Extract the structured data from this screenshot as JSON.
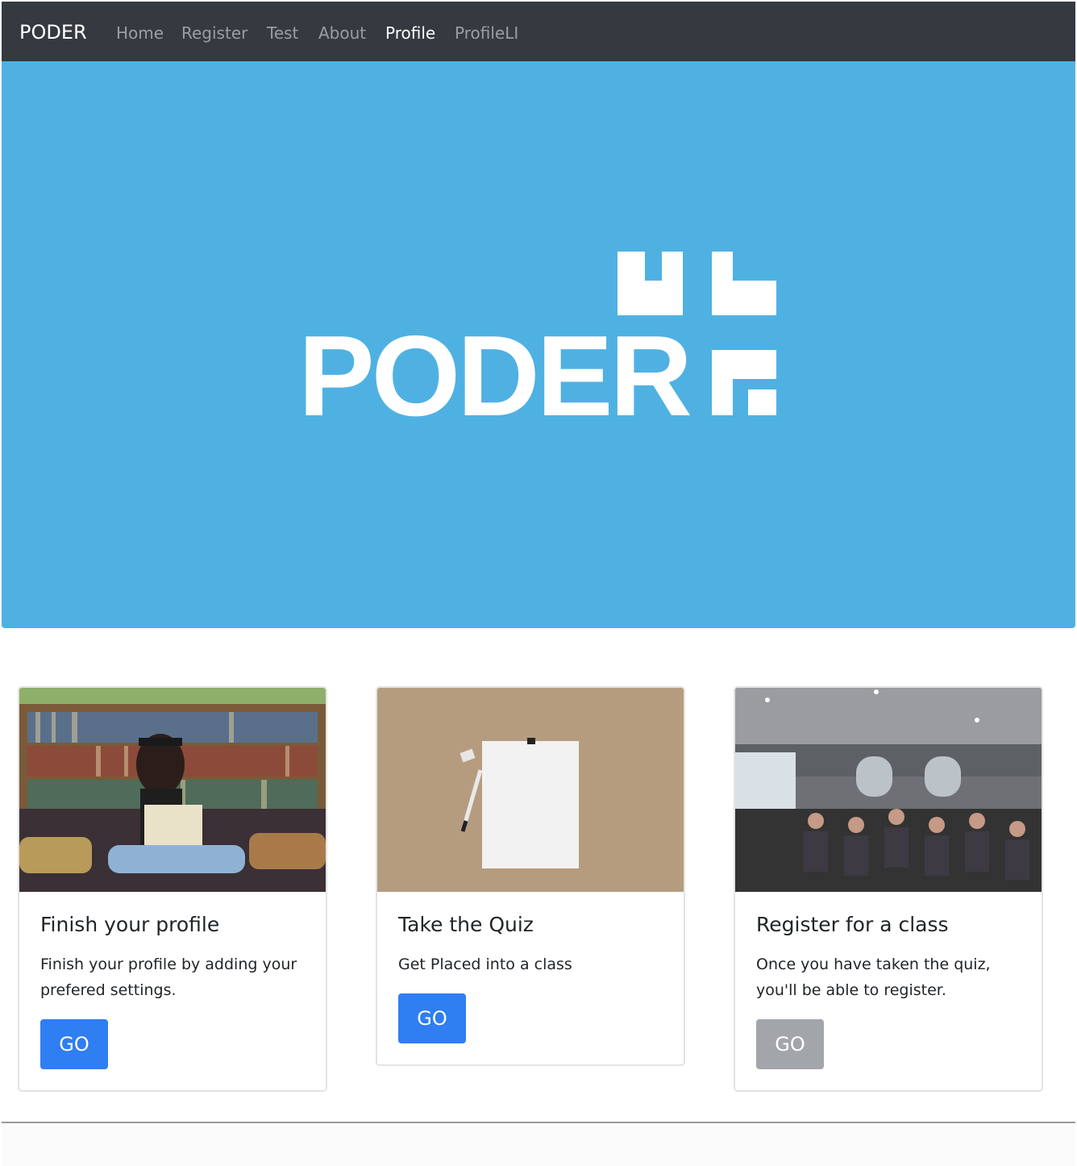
{
  "navbar": {
    "brand": "PODER",
    "links": [
      {
        "label": "Home",
        "active": false
      },
      {
        "label": "Register",
        "active": false
      },
      {
        "label": "Test",
        "active": false
      },
      {
        "label": "About",
        "active": false
      },
      {
        "label": "Profile",
        "active": true
      },
      {
        "label": "ProfileLI",
        "active": false
      }
    ]
  },
  "hero": {
    "logo_text": "PODER",
    "background_color": "#4fb1e2"
  },
  "cards": [
    {
      "title": "Finish your profile",
      "text": "Finish your profile by adding your prefered settings.",
      "button": "GO",
      "button_enabled": true,
      "image": "woman-reading-on-sofa-photo"
    },
    {
      "title": "Take the Quiz",
      "text": "Get Placed into a class",
      "button": "GO",
      "button_enabled": true,
      "image": "blank-paper-and-pen-photo"
    },
    {
      "title": "Register for a class",
      "text": "Once you have taken the quiz, you'll be able to register.",
      "button": "GO",
      "button_enabled": false,
      "image": "classroom-presentation-photo"
    }
  ],
  "colors": {
    "navbar_bg": "#343a40",
    "primary_button": "#2f7ef2",
    "disabled_button": "#a2a6ab"
  }
}
